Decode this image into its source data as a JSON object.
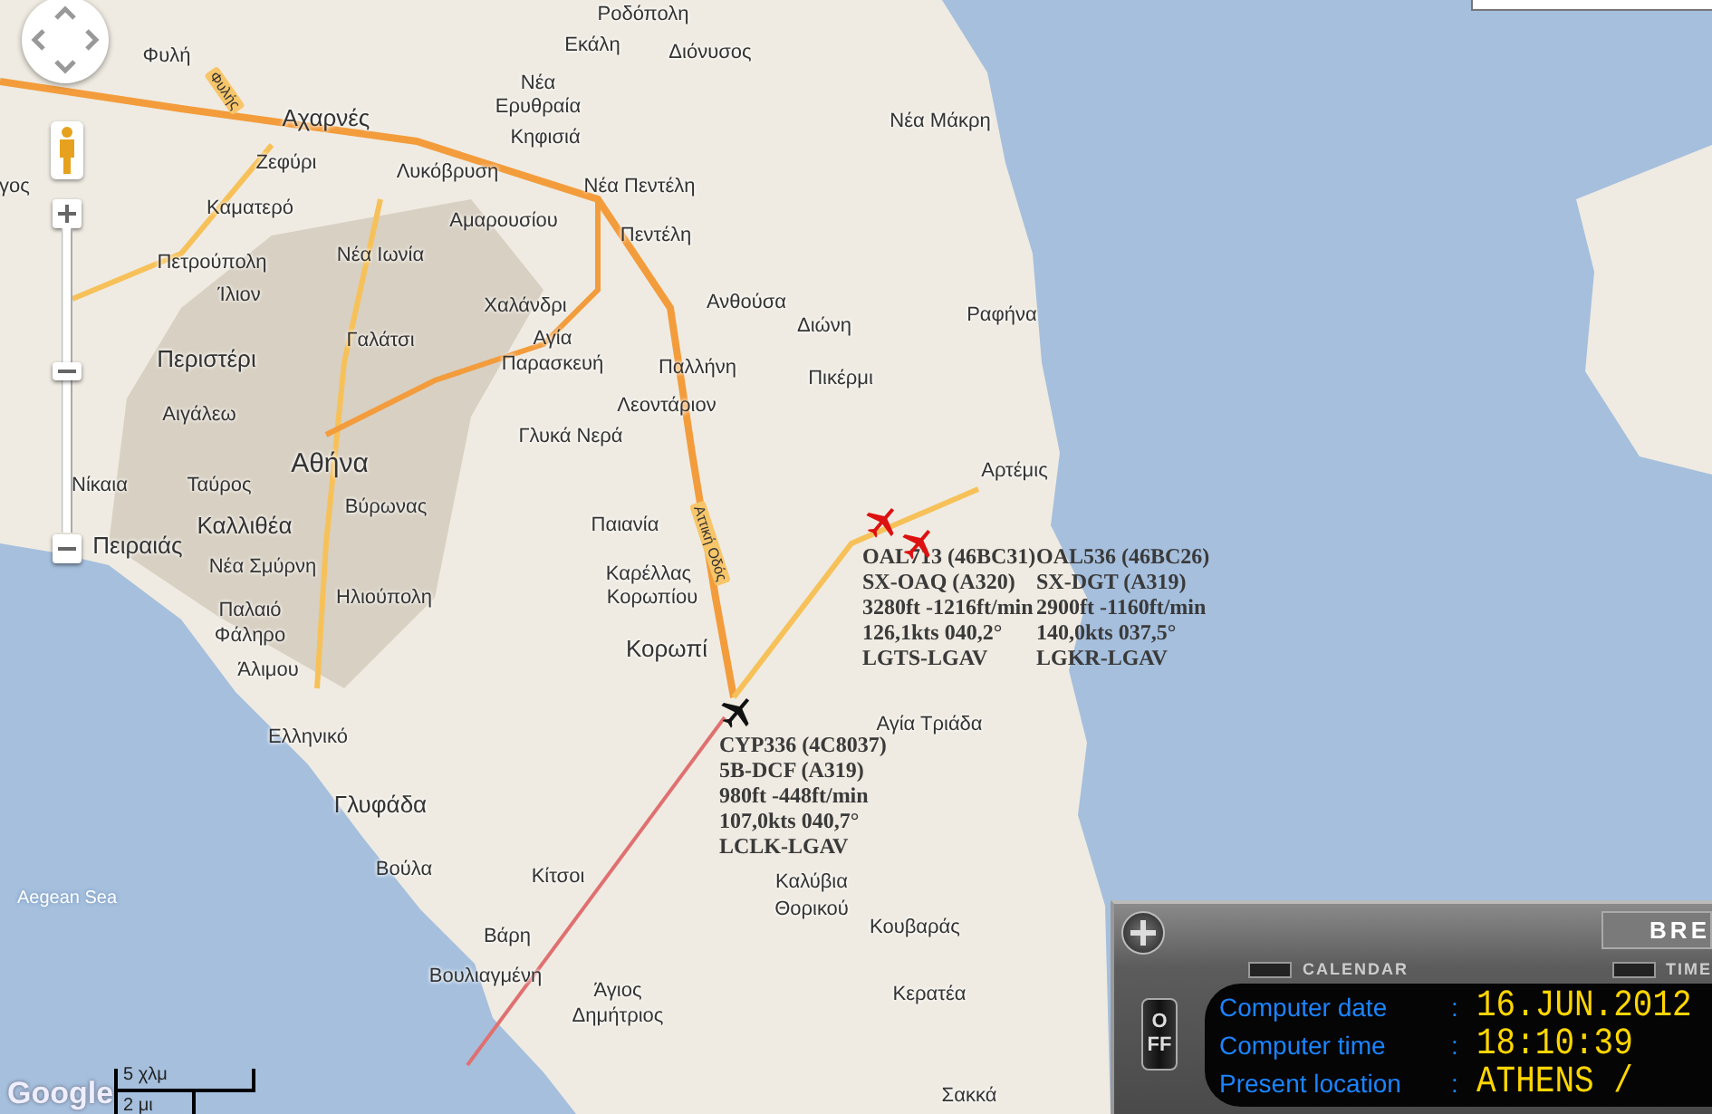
{
  "map": {
    "places": [
      "Ροδόπολη",
      "Φυλή",
      "Εκάλη",
      "Διόνυσος",
      "Νέα",
      "Ερυθραία",
      "Αχαρνές",
      "Νέα Μάκρη",
      "Κηφισιά",
      "Ζεφύρι",
      "Λυκόβρυση",
      "γος",
      "Νέα Πεντέλη",
      "Καματερό",
      "Αμαρουσίου",
      "Πεντέλη",
      "Πετρούπολη",
      "Νέα Ιωνία",
      "Ίλιον",
      "Χαλάνδρι",
      "Ανθούσα",
      "Ραφήνα",
      "Γαλάτσι",
      "Αγία",
      "Διώνη",
      "Περιστέρι",
      "Παρασκευή",
      "Παλλήνη",
      "Πικέρμι",
      "Αιγάλεω",
      "Λεοντάριον",
      "Γλυκά Νερά",
      "Αθήνα",
      "Αρτέμις",
      "Νίκαια",
      "Ταύρος",
      "Βύρωνας",
      "Καλλιθέα",
      "Παιανία",
      "Πειραιάς",
      "Νέα Σμύρνη",
      "Καρέλλας",
      "Παλαιό",
      "Ηλιούπολη",
      "Κορωπίου",
      "Φάληρο",
      "Κορωπί",
      "Άλιμου",
      "Ελληνικό",
      "Αγία Τριάδα",
      "Γλυφάδα",
      "Βούλα",
      "Κίτσοι",
      "Καλύβια",
      "Θορικού",
      "Βάρη",
      "Κουβαράς",
      "Βουλιαγμένη",
      "Άγιος",
      "Κερατέα",
      "Δημήτριος",
      "Σακκά"
    ],
    "sea_label": "Aegean Sea",
    "road_labels": [
      "Φυλής",
      "Αττική Οδός"
    ],
    "controls": {
      "zoom": {
        "level": 0.53
      }
    },
    "scale": {
      "metric": "5 χλμ",
      "imperial": "2 μι"
    },
    "logo": "Google"
  },
  "flights": [
    {
      "color": "#dd1111",
      "lines": [
        "OAL713 (46BC31)",
        "SX-OAQ (A320)",
        "3280ft -1216ft/min",
        "126,1kts 040,2°",
        "LGTS-LGAV"
      ]
    },
    {
      "color": "#dd1111",
      "lines": [
        "OAL536 (46BC26)",
        "SX-DGT (A319)",
        "2900ft -1160ft/min",
        "140,0kts 037,5°",
        "LGKR-LGAV"
      ]
    },
    {
      "color": "#111111",
      "lines": [
        "CYP336 (4C8037)",
        "5B-DCF (A319)",
        "980ft -448ft/min",
        "107,0kts 040,7°",
        "LCLK-LGAV"
      ]
    }
  ],
  "panel": {
    "brand": "BRE",
    "calendar": "CALENDAR",
    "time": "TIME",
    "off_button": "OFF",
    "rows": [
      {
        "label": "Computer date",
        "separator": ":",
        "value": "16.JUN.2012"
      },
      {
        "label": "Computer time",
        "separator": ":",
        "value": "18:10:39"
      },
      {
        "label": "Present location",
        "separator": ":",
        "value": "ATHENS /"
      }
    ]
  }
}
